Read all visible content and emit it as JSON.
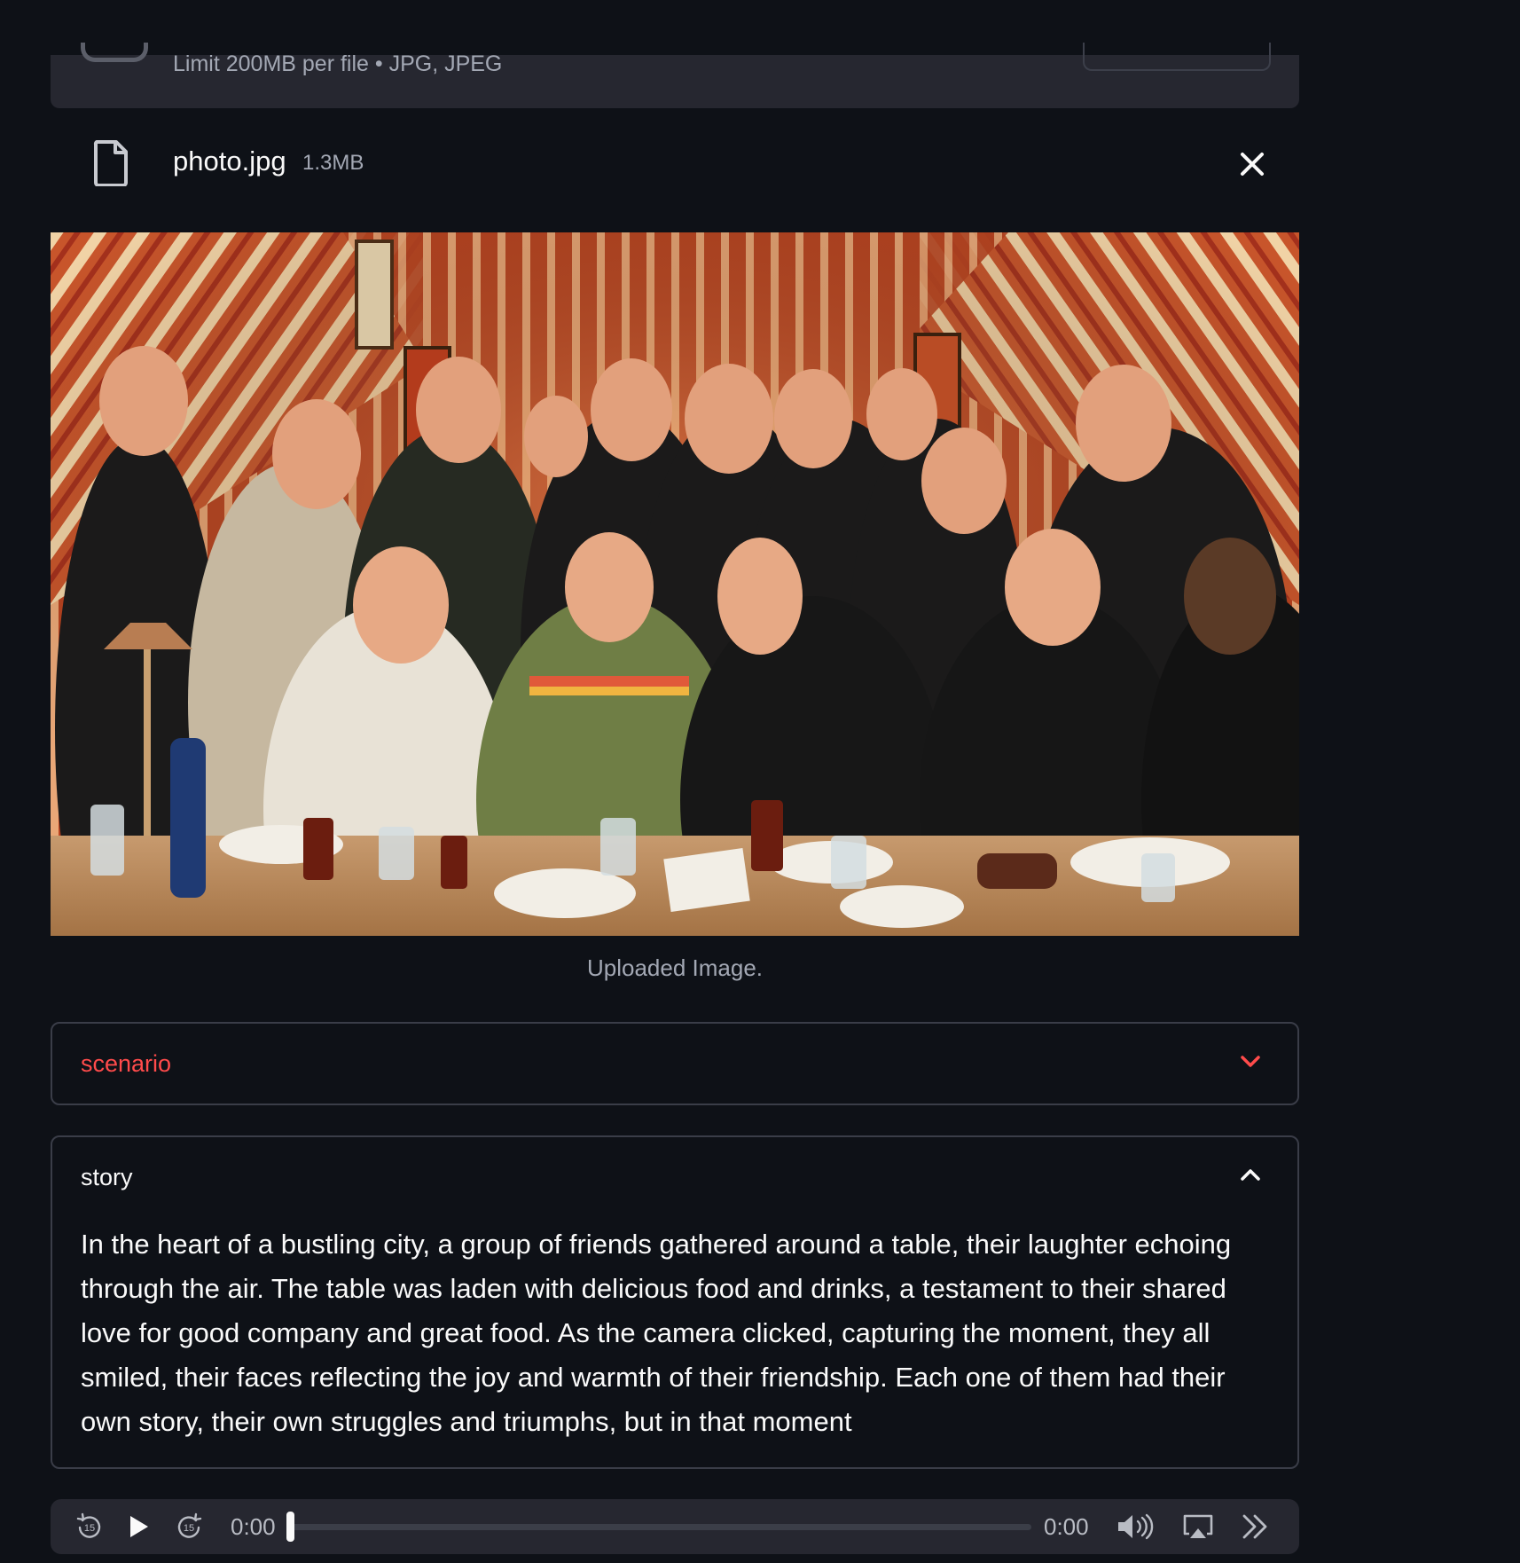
{
  "uploader": {
    "limit_text": "Limit 200MB per file • JPG, JPEG",
    "file_name": "photo.jpg",
    "file_size": "1.3MB"
  },
  "image": {
    "caption": "Uploaded Image."
  },
  "expanders": {
    "scenario": {
      "title": "scenario",
      "expanded": false
    },
    "story": {
      "title": "story",
      "expanded": true,
      "text": "In the heart of a bustling city, a group of friends gathered around a table, their laughter echoing through the air. The table was laden with delicious food and drinks, a testament to their shared love for good company and great food. As the camera clicked, capturing the moment, they all smiled, their faces reflecting the joy and warmth of their friendship. Each one of them had their own story, their own struggles and triumphs, but in that moment"
    }
  },
  "audio": {
    "current_time": "0:00",
    "duration": "0:00",
    "progress": 0,
    "rewind_seconds": "15",
    "forward_seconds": "15"
  },
  "colors": {
    "background": "#0e1117",
    "surface": "#262730",
    "accent": "#ff4b4b",
    "text": "#fafafa",
    "muted": "#a3a8b4"
  }
}
